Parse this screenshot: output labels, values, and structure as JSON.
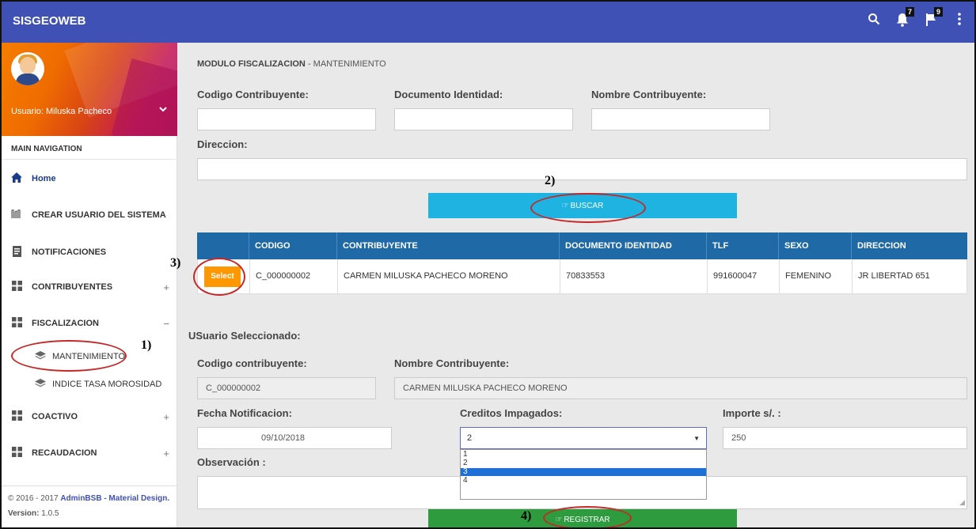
{
  "topbar": {
    "brand": "SISGEOWEB",
    "notifications_count": "7",
    "tasks_count": "9"
  },
  "sidebar": {
    "user_label": "Usuario: Miluska Pacheco",
    "section_label": "MAIN NAVIGATION",
    "items": [
      {
        "label": "Home",
        "icon": "home-icon"
      },
      {
        "label": "CREAR USUARIO DEL SISTEMA",
        "icon": "users-icon"
      },
      {
        "label": "NOTIFICACIONES",
        "icon": "document-icon"
      },
      {
        "label": "CONTRIBUYENTES",
        "icon": "apps-icon",
        "toggle": "+"
      },
      {
        "label": "FISCALIZACION",
        "icon": "apps-icon",
        "toggle": "−"
      },
      {
        "label": "COACTIVO",
        "icon": "apps-icon",
        "toggle": "+"
      },
      {
        "label": "RECAUDACION",
        "icon": "apps-icon",
        "toggle": "+"
      }
    ],
    "subitems": [
      {
        "label": "MANTENIMIENTO"
      },
      {
        "label": "INDICE TASA MOROSIDAD"
      }
    ],
    "footer_prefix": "© 2016 - 2017 ",
    "footer_link": "AdminBSB - Material Design.",
    "version_label": "Version:",
    "version_value": " 1.0.5"
  },
  "breadcrumb": {
    "module": "MODULO FISCALIZACION",
    "page": " - MANTENIMIENTO"
  },
  "search_form": {
    "codigo_label": "Codigo Contribuyente:",
    "documento_label": "Documento Identidad:",
    "nombre_label": "Nombre Contribuyente:",
    "direccion_label": "Direccion:",
    "codigo_value": "",
    "documento_value": "",
    "nombre_value": "",
    "direccion_value": "",
    "buscar_label": "BUSCAR"
  },
  "results_table": {
    "columns": [
      "",
      "CODIGO",
      "CONTRIBUYENTE",
      "DOCUMENTO IDENTIDAD",
      "TLF",
      "SEXO",
      "DIRECCION"
    ],
    "rows": [
      {
        "select_label": "Select",
        "codigo": "C_000000002",
        "contribuyente": "CARMEN MILUSKA PACHECO MORENO",
        "documento": "70833553",
        "tlf": "991600047",
        "sexo": "FEMENINO",
        "direccion": "JR LIBERTAD 651"
      }
    ]
  },
  "selected_user": {
    "title": "USuario Seleccionado:",
    "codigo_label": "Codigo contribuyente:",
    "codigo_value": "C_000000002",
    "nombre_label": "Nombre Contribuyente:",
    "nombre_value": "CARMEN MILUSKA PACHECO MORENO",
    "fecha_label": "Fecha Notificacion:",
    "fecha_value": "09/10/2018",
    "creditos_label": "Creditos Impagados:",
    "creditos_value": "2",
    "creditos_options": [
      "1",
      "2",
      "3",
      "4"
    ],
    "creditos_highlighted": "3",
    "importe_label": "Importe s/. :",
    "importe_value": "250",
    "observacion_label": "Observación :",
    "registrar_label": "REGISTRAR"
  },
  "annotations": {
    "step1": "1)",
    "step2": "2)",
    "step3": "3)",
    "step4": "4)",
    "ellipse_color": "#c62828"
  },
  "colors": {
    "topbar": "#3f51b5",
    "table_header": "#1f69a6",
    "buscar_button": "#1eb3e0",
    "registrar_button": "#2e9b3f",
    "select_button": "#ff9800"
  }
}
